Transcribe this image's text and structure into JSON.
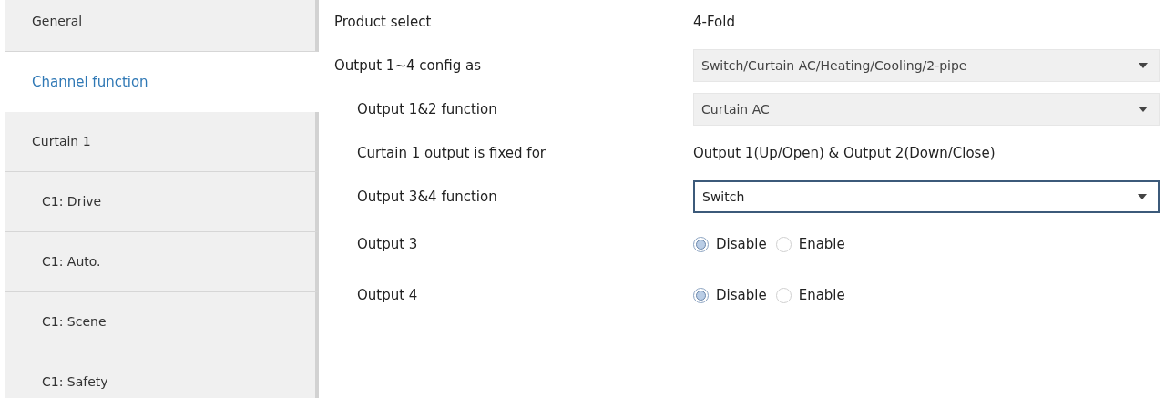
{
  "sidebar": {
    "items": [
      {
        "label": "General",
        "selected": false
      },
      {
        "label": "Channel function",
        "selected": true
      },
      {
        "label": "Curtain 1",
        "selected": false,
        "children": [
          {
            "label": "C1: Drive",
            "selected": false
          },
          {
            "label": "C1: Auto.",
            "selected": false
          },
          {
            "label": "C1: Scene",
            "selected": false
          },
          {
            "label": "C1: Safety",
            "selected": false
          }
        ]
      }
    ]
  },
  "parameters": [
    {
      "kind": "text",
      "label": "Product select",
      "value": "4-Fold"
    },
    {
      "kind": "dropdown",
      "label": "Output 1~4 config as",
      "value": "Switch/Curtain AC/Heating/Cooling/2-pipe",
      "focused": false,
      "children": [
        {
          "kind": "dropdown",
          "label": "Output 1&2 function",
          "value": "Curtain AC",
          "focused": false
        },
        {
          "kind": "text",
          "label": "Curtain 1 output is fixed for",
          "value": "Output 1(Up/Open) & Output 2(Down/Close)"
        },
        {
          "kind": "dropdown",
          "label": "Output 3&4 function",
          "value": "Switch",
          "focused": true
        },
        {
          "kind": "radio",
          "label": "Output 3",
          "options": [
            {
              "label": "Disable",
              "selected": true
            },
            {
              "label": "Enable",
              "selected": false
            }
          ]
        },
        {
          "kind": "radio",
          "label": "Output 4",
          "options": [
            {
              "label": "Disable",
              "selected": true
            },
            {
              "label": "Enable",
              "selected": false
            }
          ]
        }
      ]
    }
  ]
}
